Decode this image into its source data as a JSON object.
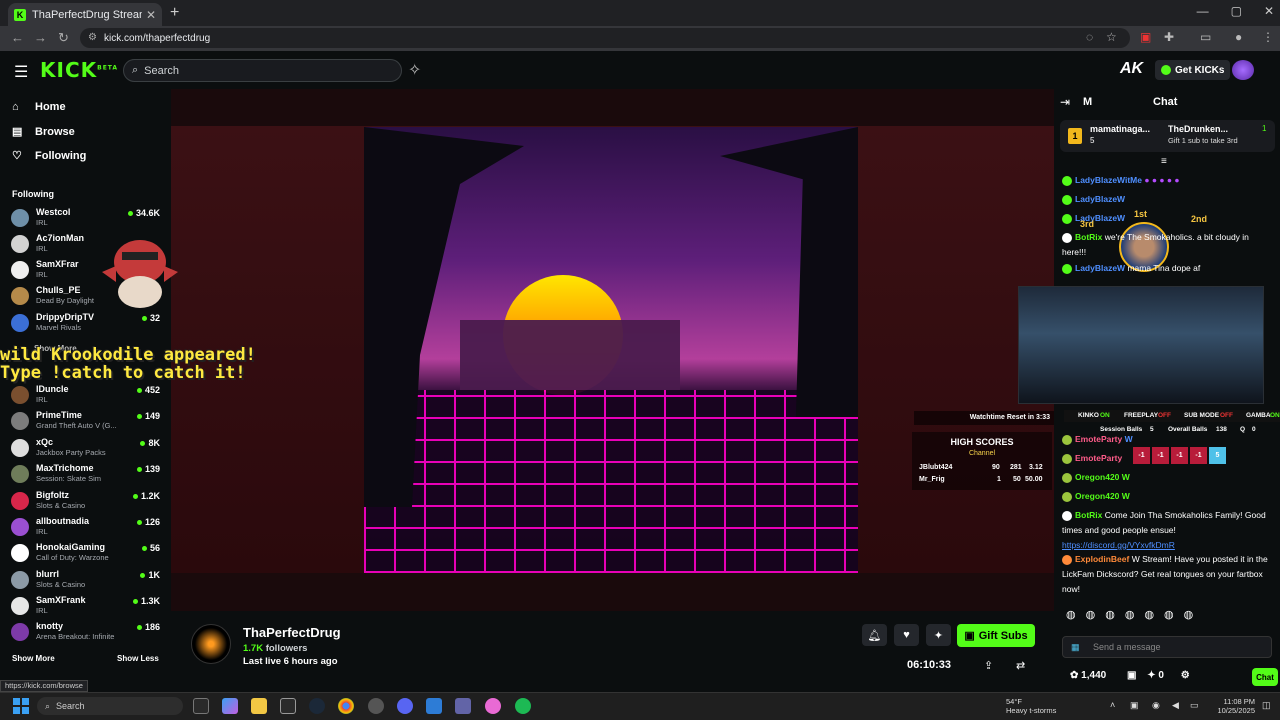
{
  "browser": {
    "tab_title": "ThaPerfectDrug Stream - Watc",
    "tab_favicon": "K",
    "close_tab": "✕",
    "new_tab": "+",
    "url": "kick.com/thaperfectdrug",
    "status_url": "https://kick.com/browse"
  },
  "header": {
    "logo": "KICK",
    "logo_sup": "BETA",
    "search_placeholder": "Search",
    "ak_logo": "AK",
    "get_kicks": "Get KICKs"
  },
  "sidebar": {
    "nav": [
      {
        "label": "Home",
        "icon": "home-icon"
      },
      {
        "label": "Browse",
        "icon": "browse-icon"
      },
      {
        "label": "Following",
        "icon": "heart-icon"
      }
    ],
    "following_header": "Following",
    "channels": [
      {
        "name": "Westcol",
        "category": "IRL",
        "viewers": "34.6K",
        "color": "#6e8fa8"
      },
      {
        "name": "Ac7ionMan",
        "category": "IRL",
        "viewers": "",
        "color": "#d2d2d2"
      },
      {
        "name": "SamXFrar",
        "category": "IRL",
        "viewers": "",
        "color": "#efefef"
      },
      {
        "name": "Chulls_PE",
        "category": "Dead By Daylight",
        "viewers": "",
        "color": "#b58a4a"
      },
      {
        "name": "DrippyDripTV",
        "category": "Marvel Rivals",
        "viewers": "32",
        "color": "#3b6fd6"
      },
      {
        "name": "lDuncle",
        "category": "IRL",
        "viewers": "452",
        "color": "#7a4f2f"
      },
      {
        "name": "PrimeTime",
        "category": "Grand Theft Auto V (G...",
        "viewers": "149",
        "color": "#7c7c7c"
      },
      {
        "name": "xQc",
        "category": "Jackbox Party Packs",
        "viewers": "8K",
        "color": "#dedede"
      },
      {
        "name": "MaxTrichome",
        "category": "Session: Skate Sim",
        "viewers": "139",
        "color": "#6f7d5a"
      },
      {
        "name": "Bigfoltz",
        "category": "Slots & Casino",
        "viewers": "1.2K",
        "color": "#d8264a"
      },
      {
        "name": "allboutnadia",
        "category": "IRL",
        "viewers": "126",
        "color": "#9a4fd1"
      },
      {
        "name": "HonokaiGaming",
        "category": "Call of Duty: Warzone",
        "viewers": "56",
        "color": "#ffffff"
      },
      {
        "name": "blurrl",
        "category": "Slots & Casino",
        "viewers": "1K",
        "color": "#8c9aa6"
      },
      {
        "name": "SamXFrank",
        "category": "IRL",
        "viewers": "1.3K",
        "color": "#e6e6e6"
      },
      {
        "name": "knotty",
        "category": "Arena Breakout: Infinite",
        "viewers": "186",
        "color": "#7d3aa8"
      }
    ],
    "show_more_partial": "Show More",
    "show_more": "Show More",
    "show_less": "Show Less"
  },
  "overlay": {
    "poke_line1": "wild Krookodile appeared!",
    "poke_line2": "Type !catch to catch it!",
    "watchtime": "Watchtime Reset in 3:33",
    "high_scores": {
      "title": "HIGH SCORES",
      "subtitle": "Channel",
      "rows": [
        {
          "name": "JBlubt424",
          "a": "90",
          "b": "281",
          "c": "3.12"
        },
        {
          "name": "Mr_Frig",
          "a": "1",
          "b": "50",
          "c": "50.00"
        }
      ]
    }
  },
  "channel": {
    "name": "ThaPerfectDrug",
    "followers_count": "1.7K",
    "followers_label": "followers",
    "last_live": "Last live 6 hours ago",
    "gift_subs": "Gift Subs",
    "timer": "06:10:33"
  },
  "chat": {
    "title": "Chat",
    "m_label": "M",
    "pinned": {
      "rank": "1",
      "user1": "mamatinaga...",
      "count1": "5",
      "user2": "TheDrunken...",
      "count2": "1",
      "gift_text": "Gift 1 sub to take 3rd"
    },
    "messages": [
      {
        "user": "LadyBlazeWitMe",
        "text": "",
        "color": "#4f8fff"
      },
      {
        "user": "LadyBlazeW",
        "text": "",
        "color": "#4f8fff"
      },
      {
        "user": "LadyBlazeW",
        "text": "",
        "color": "#4f8fff"
      },
      {
        "user": "BotRix",
        "text": "we're The Smokaholics. a bit cloudy in here!!!",
        "color": "#53fc18"
      },
      {
        "user": "LadyBlazeW",
        "text": "mama Tina dope af",
        "color": "#4f8fff"
      }
    ],
    "rank_badges": {
      "first": "1st",
      "second": "2nd",
      "third": "3rd"
    },
    "overlay_bar": {
      "kinko": "KINKO",
      "kinko_state": "ON",
      "freeplay": "FREEPLAY",
      "freeplay_state": "OFF",
      "submode": "SUB MODE",
      "submode_state": "OFF",
      "gamba": "GAMBA",
      "gamba_state": "ON"
    },
    "balls": {
      "session_label": "Session Balls",
      "session": "5",
      "overall_label": "Overall Balls",
      "overall": "138",
      "q": "Q",
      "q_val": "0"
    },
    "votes": [
      "-1",
      "-1",
      "-1",
      "-1",
      "5"
    ],
    "messages2": [
      {
        "user": "EmoteParty",
        "text": "W",
        "color": "#ff5c8a"
      },
      {
        "user": "EmoteParty",
        "text": "",
        "color": "#ff5c8a"
      },
      {
        "user": "Oregon420",
        "text": "W",
        "color": "#53fc18"
      },
      {
        "user": "Oregon420",
        "text": "W",
        "color": "#53fc18"
      },
      {
        "user": "BotRix",
        "text": "Come Join Tha Smokaholics Family! Good times and good people ensue!",
        "color": "#53fc18"
      },
      {
        "user": "ExplodinBeef",
        "text": "W Stream! Have you posted it in the LickFam Dickscord? Get real tongues on your fartbox now!",
        "color": "#ff8a3a"
      }
    ],
    "discord_link": "https://discord.gg/VYxvfkDmR",
    "send_placeholder": "Send a message",
    "points": "1,440",
    "points_zero": "0",
    "chat_button": "Chat"
  },
  "taskbar": {
    "search": "Search",
    "weather_temp": "54°F",
    "weather_desc": "Heavy t-storms",
    "time": "11:08 PM",
    "date": "10/25/2025"
  }
}
